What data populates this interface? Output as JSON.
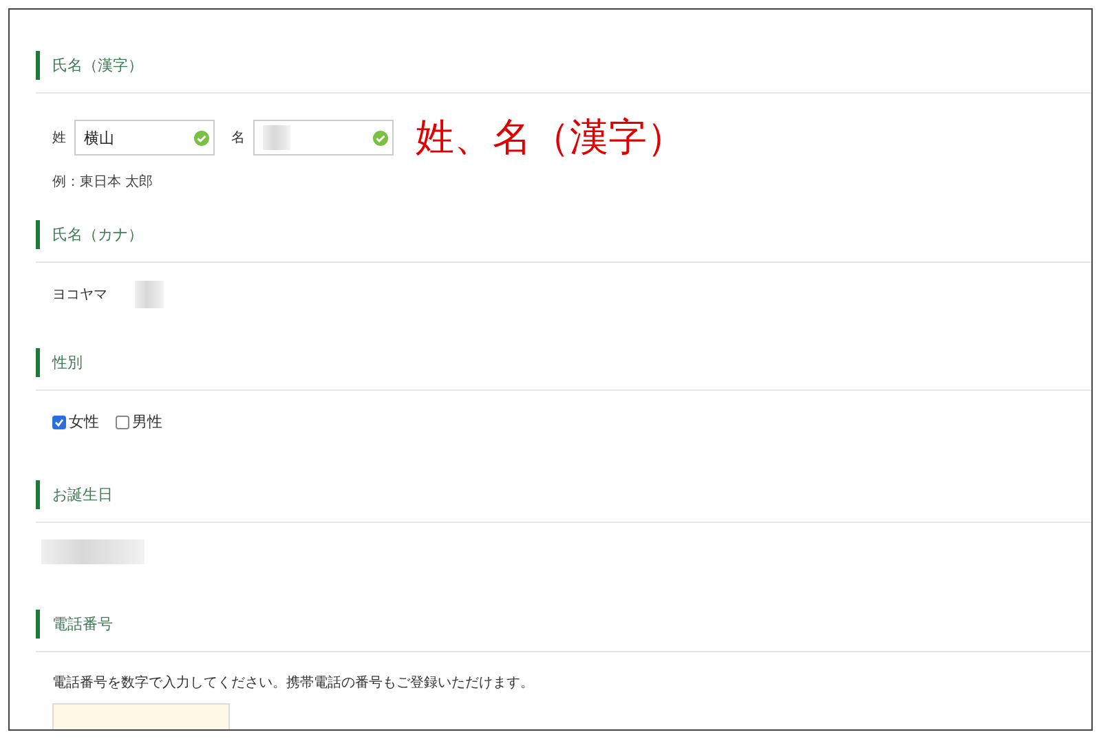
{
  "sections": [
    {
      "title": "氏名（漢字）",
      "kind": "name_fields",
      "fields": [
        {
          "label": "姓",
          "value": "横山",
          "valid": true,
          "blurred": false
        },
        {
          "label": "名",
          "valid": true,
          "blurred": true
        }
      ],
      "hint": "例：東日本 太郎",
      "annotation": "姓、名（漢字）"
    },
    {
      "title": "氏名（カナ）",
      "kind": "text",
      "value": "ヨコヤマ"
    },
    {
      "title": "性別",
      "kind": "checkboxes",
      "options": [
        {
          "label": "女性",
          "checked": true
        },
        {
          "label": "男性",
          "checked": false
        }
      ]
    },
    {
      "title": "お誕生日",
      "kind": "blurred"
    },
    {
      "title": "電話番号",
      "kind": "phone",
      "help": "電話番号を数字で入力してください。携帯電話の番号もご登録いただけます。"
    }
  ]
}
